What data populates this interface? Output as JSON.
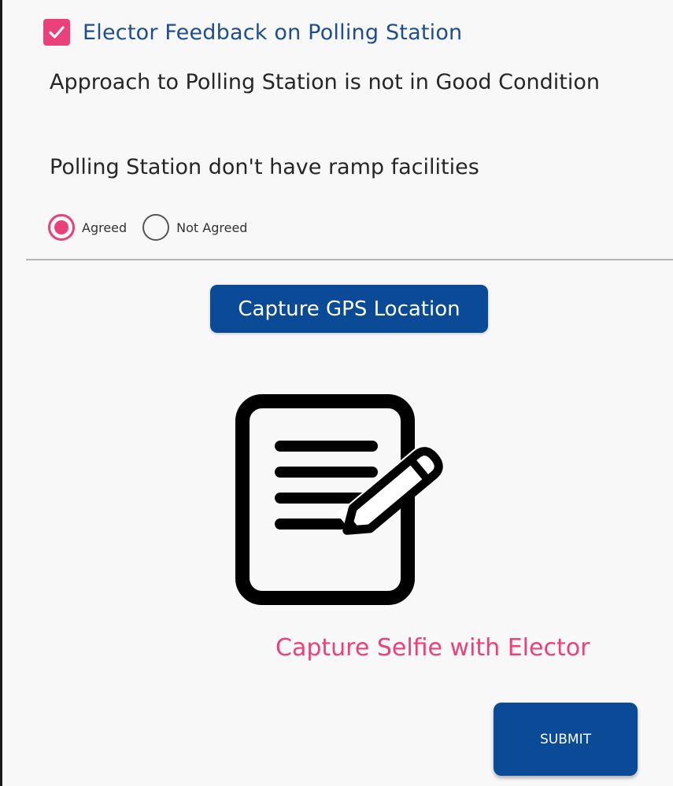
{
  "section": {
    "checked": true,
    "title": "Elector Feedback on Polling Station"
  },
  "feedback": {
    "items": [
      "Approach to Polling Station is not in Good Condition",
      "Polling Station don't have ramp facilities"
    ]
  },
  "agreement": {
    "options": [
      "Agreed",
      "Not Agreed"
    ],
    "selected": "Agreed"
  },
  "gps": {
    "label": "Capture GPS Location"
  },
  "selfie": {
    "icon": "document-edit-icon",
    "label": "Capture Selfie with Elector"
  },
  "submit": {
    "label": "SUBMIT"
  },
  "colors": {
    "accent": "#ec407a",
    "primary": "#0b4a96",
    "title": "#1e4e8c"
  }
}
